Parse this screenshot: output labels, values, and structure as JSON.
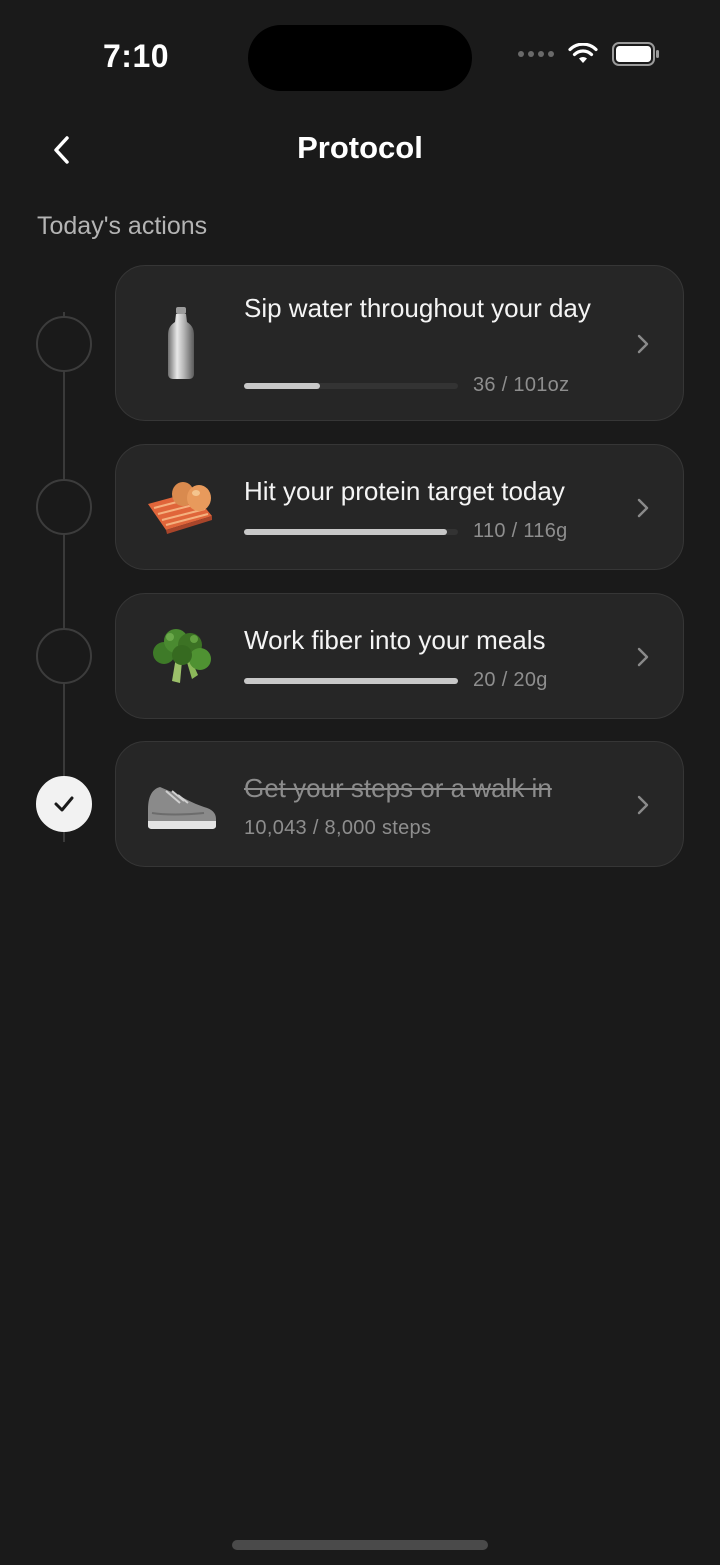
{
  "status_bar": {
    "time": "7:10"
  },
  "header": {
    "title": "Protocol"
  },
  "section": {
    "label": "Today's actions"
  },
  "actions": [
    {
      "title": "Sip water throughout your day",
      "value": "36 / 101oz",
      "progress": 0.356,
      "completed": false,
      "icon": "water-bottle-icon"
    },
    {
      "title": "Hit your protein target today",
      "value": "110 / 116g",
      "progress": 0.948,
      "completed": false,
      "icon": "salmon-eggs-icon"
    },
    {
      "title": "Work fiber into your meals",
      "value": "20 / 20g",
      "progress": 1.0,
      "completed": false,
      "icon": "broccoli-icon"
    },
    {
      "title": "Get your steps or a walk in",
      "value": "10,043 / 8,000 steps",
      "completed": true,
      "icon": "sneaker-icon"
    }
  ]
}
